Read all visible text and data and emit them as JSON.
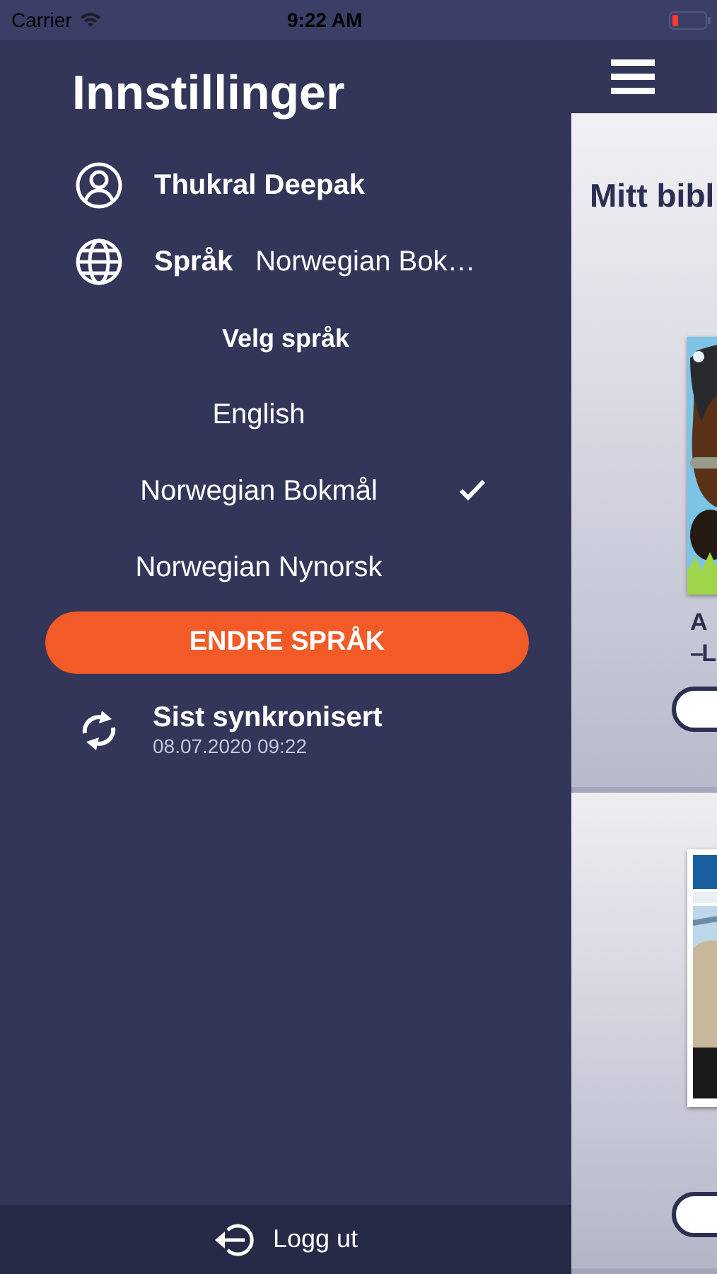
{
  "status_bar": {
    "carrier": "Carrier",
    "time": "9:22 AM"
  },
  "drawer": {
    "title": "Innstillinger",
    "user": {
      "name": "Thukral Deepak"
    },
    "language": {
      "label": "Språk",
      "value": "Norwegian Bok…",
      "heading": "Velg språk",
      "options": [
        {
          "label": "English",
          "selected": false
        },
        {
          "label": "Norwegian Bokmål",
          "selected": true
        },
        {
          "label": "Norwegian Nynorsk",
          "selected": false
        }
      ]
    },
    "change_button": "ENDRE SPRÅK",
    "sync": {
      "label": "Sist synkronisert",
      "time": "08.07.2020 09:22"
    },
    "logout": "Logg ut"
  },
  "library": {
    "title": "Mitt bibl",
    "books": [
      {
        "kind": "picture",
        "title_lines": [
          "A",
          "– L"
        ]
      },
      {
        "kind": "picture"
      }
    ]
  }
}
